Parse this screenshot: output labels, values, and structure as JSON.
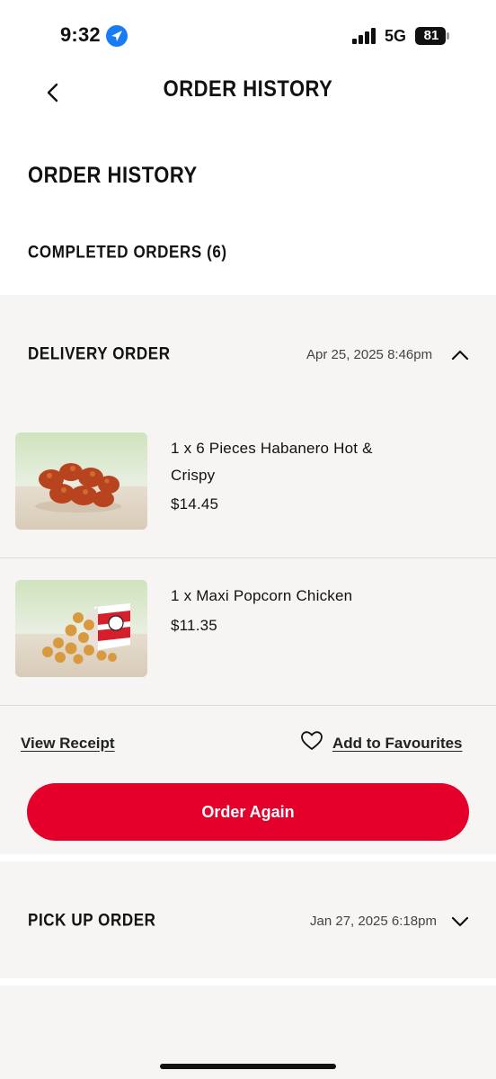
{
  "status_bar": {
    "time": "9:32",
    "network": "5G",
    "battery": "81"
  },
  "header": {
    "title": "ORDER HISTORY",
    "back_icon": "chevron-left-icon"
  },
  "page": {
    "section_title": "ORDER HISTORY",
    "completed_label": "COMPLETED ORDERS (6)"
  },
  "orders": [
    {
      "type": "DELIVERY ORDER",
      "date": "Apr 25, 2025 8:46pm",
      "expanded": true,
      "items": [
        {
          "name": "1 x 6 Pieces Habanero Hot & Crispy",
          "price": "$14.45",
          "image": "habanero-chicken-image"
        },
        {
          "name": "1 x Maxi Popcorn Chicken",
          "price": "$11.35",
          "image": "popcorn-chicken-image"
        }
      ],
      "view_receipt": "View Receipt",
      "add_favourites": "Add to Favourites",
      "order_again": "Order Again"
    },
    {
      "type": "PICK UP ORDER",
      "date": "Jan 27, 2025 6:18pm",
      "expanded": false
    }
  ],
  "colors": {
    "accent": "#e4002b",
    "card_bg": "#f6f5f3",
    "location": "#1a7cf5"
  }
}
